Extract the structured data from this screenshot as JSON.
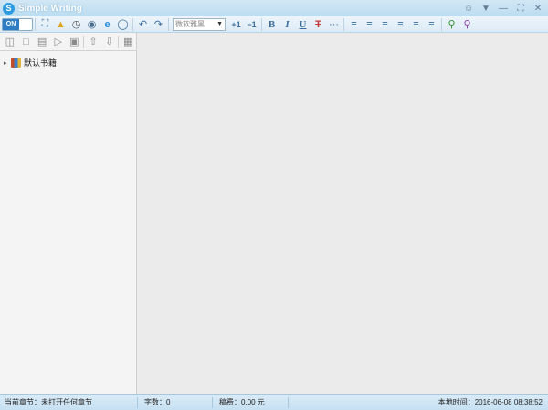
{
  "window": {
    "title": "Simple Writing",
    "logo_letter": "S",
    "controls": [
      "user-icon",
      "dropdown-icon",
      "minimize-icon",
      "maximize-icon",
      "close-icon"
    ]
  },
  "toolbar": {
    "toggle_label": "ON",
    "font_placeholder": "微软雅黑",
    "font_size_plus": "+1",
    "font_size_minus": "−1",
    "bold": "B",
    "italic": "I",
    "underline": "U",
    "strike": "T",
    "more": "···"
  },
  "sidebar": {
    "tree_root": "默认书籍"
  },
  "status": {
    "current_chapter": "当前章节：未打开任何章节",
    "word_count": "字数：0",
    "royalty": "稿费：0.00 元",
    "local_time": "本地时间：2016-06-08 08:38:52"
  },
  "colors": {
    "accent": "#2f7dc4",
    "titlebar": "#c8e2f3"
  }
}
